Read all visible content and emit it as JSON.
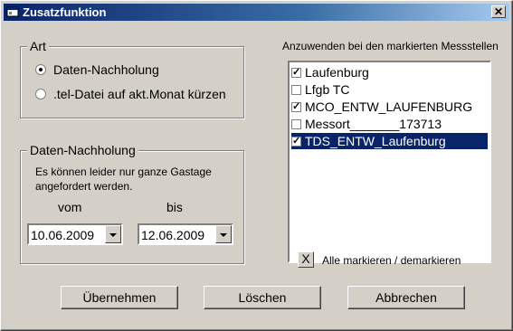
{
  "window": {
    "title": "Zusatzfunktion",
    "close_label": "✕"
  },
  "art": {
    "group_label": "Art",
    "options": [
      {
        "label": "Daten-Nachholung",
        "checked": true
      },
      {
        "label": ".tel-Datei auf akt.Monat kürzen",
        "checked": false
      }
    ]
  },
  "nachholung": {
    "group_label": "Daten-Nachholung",
    "info_text_1": "Es können leider nur ganze Gastage",
    "info_text_2": "angefordert werden.",
    "vom_label": "vom",
    "bis_label": "bis",
    "vom_value": "10.06.2009",
    "bis_value": "12.06.2009"
  },
  "messstellen": {
    "header": "Anzuwenden bei den markierten Messstellen",
    "items": [
      {
        "label": "Laufenburg",
        "checked": true,
        "selected": false
      },
      {
        "label": "Lfgb TC",
        "checked": false,
        "selected": false
      },
      {
        "label": "MCO_ENTW_LAUFENBURG",
        "checked": true,
        "selected": false
      },
      {
        "label": "Messort_______173713",
        "checked": false,
        "selected": false
      },
      {
        "label": "TDS_ENTW_Laufenburg",
        "checked": true,
        "selected": true
      }
    ],
    "toggle_all_label": "Alle markieren / demarkieren",
    "toggle_all_button": "X"
  },
  "buttons": {
    "apply": "Übernehmen",
    "delete": "Löschen",
    "cancel": "Abbrechen"
  }
}
